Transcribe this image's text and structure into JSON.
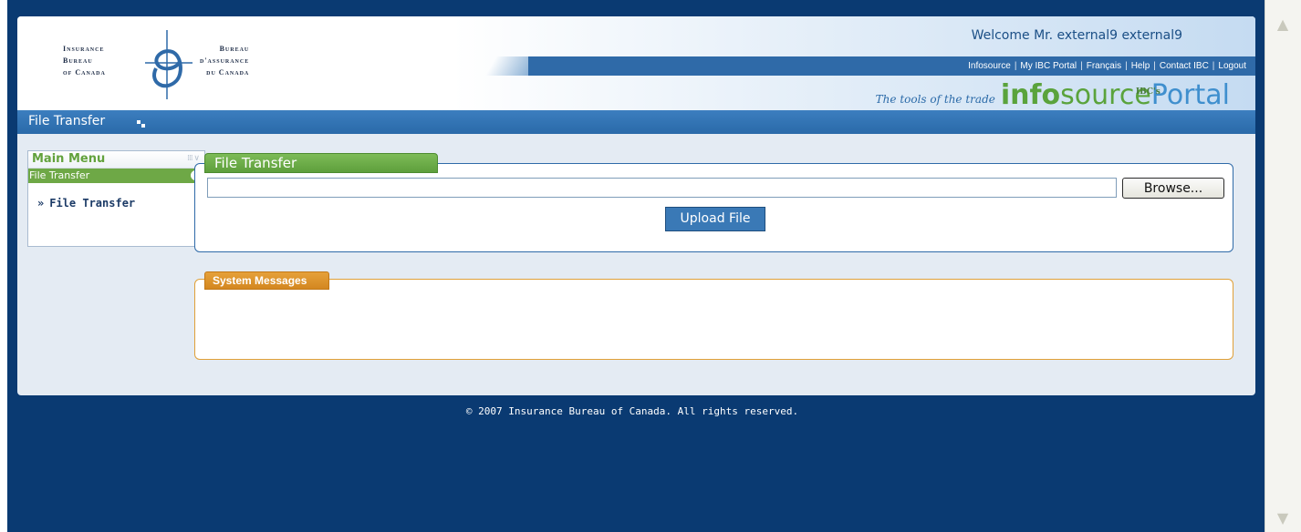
{
  "header": {
    "logo": {
      "left_lines": [
        "Insurance",
        "Bureau",
        "of Canada"
      ],
      "right_lines": [
        "Bureau",
        "d'assurance",
        "du Canada"
      ]
    },
    "welcome": "Welcome Mr. external9 external9",
    "nav": [
      "Infosource",
      "My IBC Portal",
      "Français",
      "Help",
      "Contact IBC",
      "Logout"
    ],
    "tagline": "The tools of the trade",
    "brand_small": "IBC's",
    "brand_part1": "info",
    "brand_part2": "source",
    "brand_part3": "Portal"
  },
  "title_bar": {
    "title": "File Transfer"
  },
  "sidebar": {
    "menu_title": "Main Menu",
    "section_label": "File Transfer",
    "items": [
      {
        "label": "File Transfer"
      }
    ]
  },
  "file_transfer": {
    "panel_title": "File Transfer",
    "file_value": "",
    "browse_label": "Browse...",
    "upload_label": "Upload File"
  },
  "system_messages": {
    "panel_title": "System Messages"
  },
  "footer": {
    "copyright": "© 2007 Insurance Bureau of Canada. All rights reserved."
  },
  "colors": {
    "background": "#0a3a72",
    "page": "#e4ebf3",
    "title_bar": "#2f6aa8",
    "menu_green": "#6ea846",
    "messages_orange": "#d48720"
  }
}
